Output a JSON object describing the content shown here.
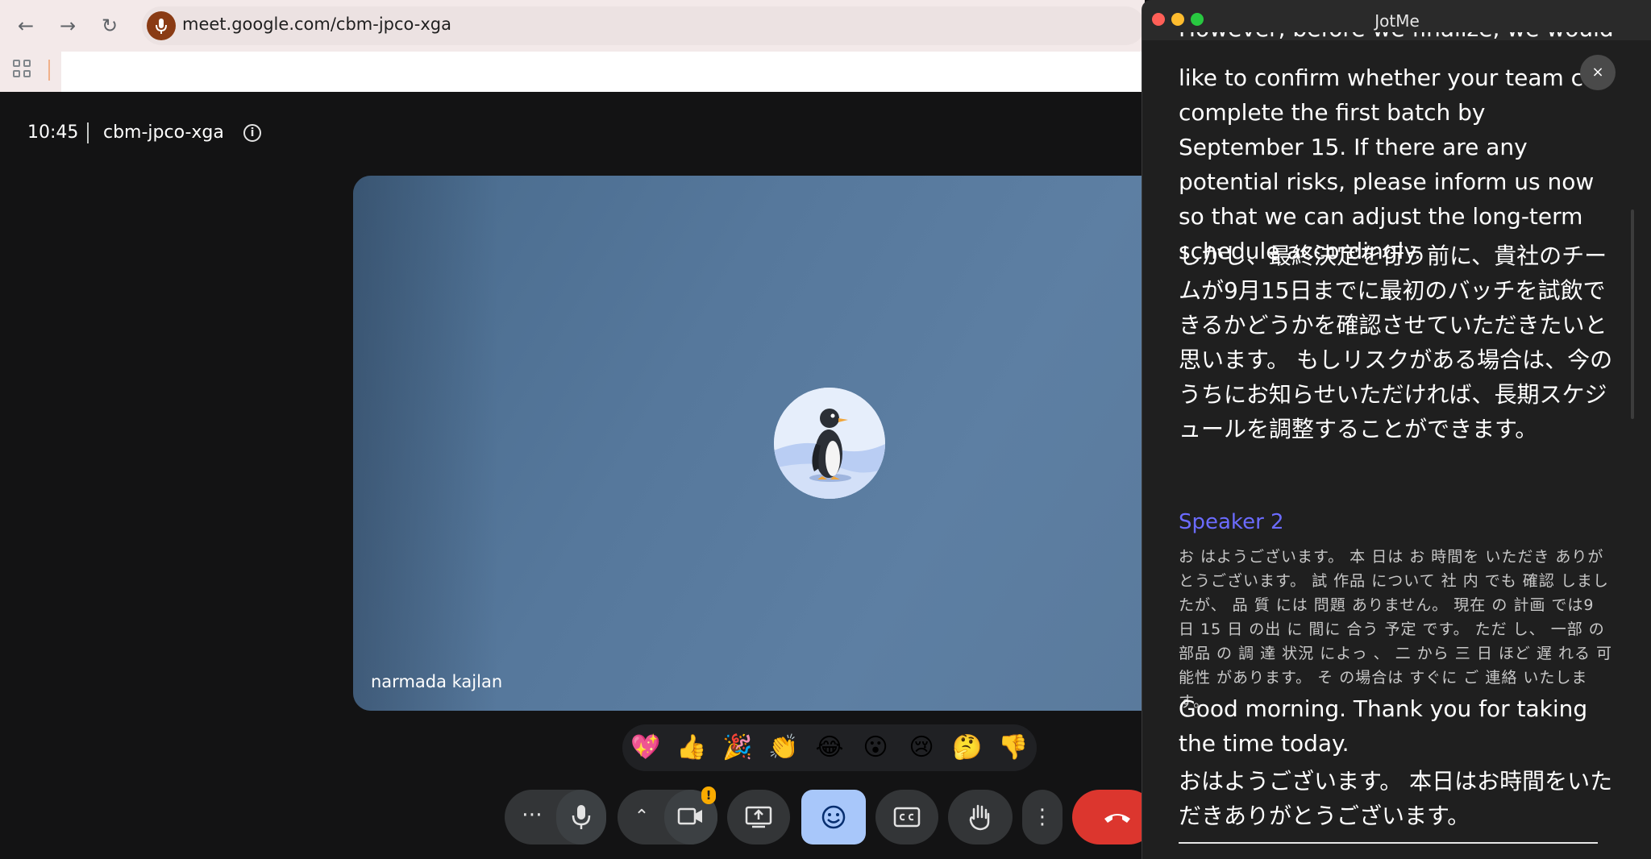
{
  "browser": {
    "url": "meet.google.com/cbm-jpco-xga"
  },
  "meet": {
    "time": "10:45",
    "meeting_code": "cbm-jpco-xga",
    "participant_name": "narmada kajlan",
    "reactions": [
      "💖",
      "👍",
      "🎉",
      "👏",
      "😂",
      "😮",
      "😢",
      "🤔",
      "👎"
    ]
  },
  "jotme": {
    "title": "JotMe",
    "close_label": "×",
    "partial_top": "However, before we finalize, we would",
    "block1_en": "like to confirm whether your team can complete the first batch by September 15. If there are any potential risks, please inform us now so that we can adjust the long-term schedule accordingly.",
    "block1_ja": "しかし、最終決定を行う前に、貴社のチームが9月15日までに最初のバッチを試飲できるかどうかを確認させていただきたいと思います。 もしリスクがある場合は、今のうちにお知らせいただければ、長期スケジュールを調整することができます。",
    "speaker": "Speaker 2",
    "speaker_ja_raw": "お はようございます。 本 日は お 時間を いただき ありがとうございます。 試 作品 について 社 内 でも 確認 しましたが、 品 質 には 問題 ありません。 現在 の 計画 では9 日 15 日 の出 に 間に 合う 予定 です。 ただ し、 一部 の 部品 の 調 達 状況 によっ 、 二 から 三 日 ほど 遅 れる 可能性 があります。 そ の場合は すぐに ご 連絡 いたします。",
    "block2_en": "Good morning. Thank you for taking the time today.",
    "block2_ja": "おはようございます。 本日はお時間をいただきありがとうございます。"
  },
  "colors": {
    "meet_bg": "#131314",
    "tile": "#56789c",
    "end_call": "#dc362e",
    "reactions_active": "#a8c7fa",
    "speaker_label": "#6b6bff",
    "jot_bg": "#1f1f1f"
  }
}
